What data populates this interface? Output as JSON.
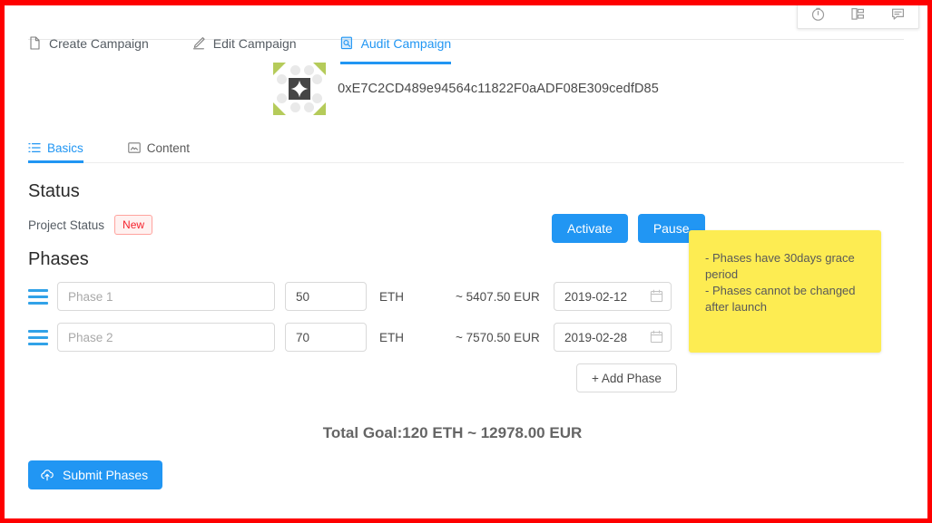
{
  "devtools": {
    "icons": [
      {
        "name": "clock-icon",
        "label": "History"
      },
      {
        "name": "tree-structure-icon",
        "label": "Component Tree"
      },
      {
        "name": "comment-bubble-icon",
        "label": "Comments"
      }
    ]
  },
  "main_tabs": [
    {
      "label": "Create Campaign",
      "icon": "file-icon",
      "active": false
    },
    {
      "label": "Edit Campaign",
      "icon": "pencil-icon",
      "active": false
    },
    {
      "label": "Audit Campaign",
      "icon": "file-search-icon",
      "active": true
    }
  ],
  "account": {
    "address": "0xE7C2CD489e94564c11822F0aADF08E309cedfD85",
    "identicon": {
      "name": "jazzicon-avatar",
      "corner_color": "#b5cb5a",
      "dot_color": "#e9e9e9",
      "center_color": "#454545"
    }
  },
  "sub_tabs": [
    {
      "label": "Basics",
      "icon": "ordered-list-icon",
      "active": true
    },
    {
      "label": "Content",
      "icon": "picture-text-icon",
      "active": false
    }
  ],
  "status_section": {
    "title": "Status",
    "project_status_label": "Project Status",
    "project_status_value": "New",
    "badge_color": "#f5222d",
    "activate_label": "Activate",
    "pause_label": "Pause"
  },
  "phases_section": {
    "title": "Phases",
    "unit_label": "ETH",
    "name_placeholder": "Phase 1",
    "rows": [
      {
        "name_placeholder": "Phase 1",
        "amount": "50",
        "unit": "ETH",
        "fiat": "~ 5407.50 EUR",
        "date": "2019-02-12"
      },
      {
        "name_placeholder": "Phase 2",
        "amount": "70",
        "unit": "ETH",
        "fiat": "~ 7570.50 EUR",
        "date": "2019-02-28"
      }
    ],
    "add_phase_label": "+ Add Phase",
    "total_goal": "Total Goal:120 ETH ~ 12978.00 EUR",
    "submit_label": "Submit Phases"
  },
  "note": {
    "line1": "- Phases have 30days grace period",
    "line2": "- Phases cannot be changed after launch",
    "background": "#fdec52"
  },
  "theme": {
    "accent": "#2196f3",
    "frame": "#fe0000"
  }
}
